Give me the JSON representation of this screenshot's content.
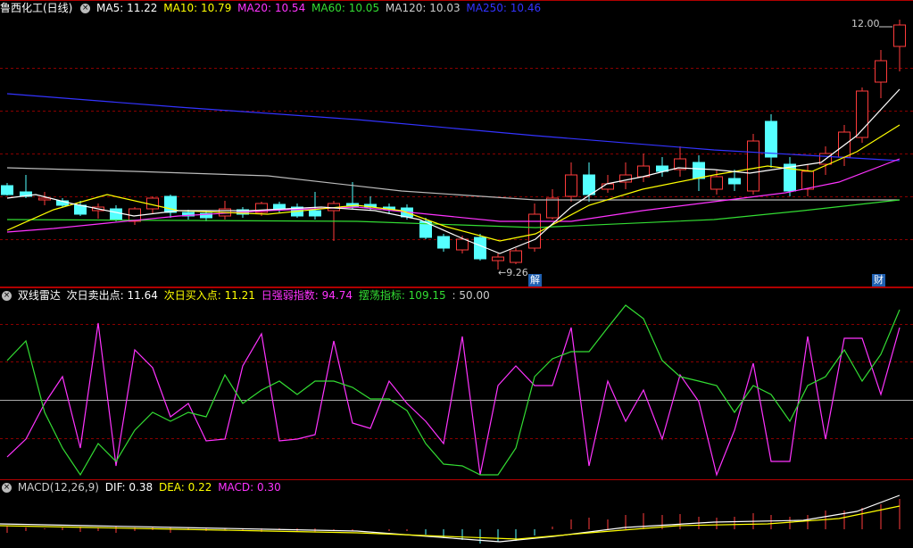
{
  "main": {
    "title": "鲁西化工(日线)",
    "ma": [
      {
        "label": "MA5: 11.22",
        "color": "#ffffff"
      },
      {
        "label": "MA10: 10.79",
        "color": "#ffff00"
      },
      {
        "label": "MA20: 10.54",
        "color": "#ff33ff"
      },
      {
        "label": "MA60: 10.05",
        "color": "#33dd33"
      },
      {
        "label": "MA120: 10.03",
        "color": "#cccccc"
      },
      {
        "label": "MA250: 10.46",
        "color": "#3333ff"
      }
    ],
    "high_label": "12.00",
    "low_label": "9.26",
    "marker_jie": "解",
    "marker_cai": "财"
  },
  "osc": {
    "name": "双线雷达",
    "items": [
      {
        "label": "次日卖出点: 11.64",
        "color": "#ffffff"
      },
      {
        "label": "次日买入点: 11.21",
        "color": "#ffff00"
      },
      {
        "label": "日强弱指数: 94.74",
        "color": "#ff33ff"
      },
      {
        "label": "摆荡指标: 109.15",
        "color": "#33dd33"
      },
      {
        "label": ": 50.00",
        "color": "#cccccc"
      }
    ]
  },
  "macd": {
    "name": "MACD(12,26,9)",
    "items": [
      {
        "label": "DIF: 0.38",
        "color": "#ffffff"
      },
      {
        "label": "DEA: 0.22",
        "color": "#ffff00"
      },
      {
        "label": "MACD: 0.30",
        "color": "#ff33ff"
      }
    ]
  },
  "colors": {
    "up": "#ff3b3b",
    "down": "#55ffff",
    "grid": "#8a0000"
  }
}
